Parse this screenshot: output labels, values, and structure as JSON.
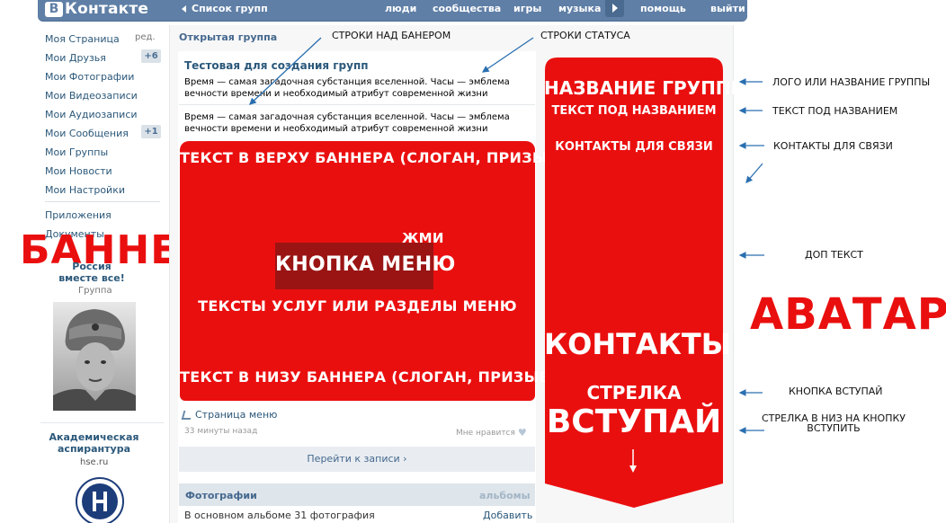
{
  "header": {
    "logo_text": "Контакте",
    "logo_letter": "В",
    "back_link": "Список групп",
    "nav": [
      "люди",
      "сообщества",
      "игры",
      "музыка",
      "помощь",
      "выйти"
    ]
  },
  "left_menu": {
    "edit_label": "ред.",
    "items": [
      {
        "label": "Моя Страница"
      },
      {
        "label": "Мои Друзья",
        "badge": "+6"
      },
      {
        "label": "Мои Фотографии"
      },
      {
        "label": "Мои Видеозаписи"
      },
      {
        "label": "Мои Аудиозаписи"
      },
      {
        "label": "Мои Сообщения",
        "badge": "+1"
      },
      {
        "label": "Мои Группы"
      },
      {
        "label": "Мои Новости"
      },
      {
        "label": "Мои Настройки"
      }
    ],
    "apps": "Приложения",
    "documents": "Документы"
  },
  "left_group": {
    "title": "Россия вместе все!",
    "type": "Группа"
  },
  "academy": {
    "title": "Академическая аспирантура",
    "url": "hse.ru"
  },
  "group_page": {
    "open_group_label": "Открытая группа",
    "title": "Тестовая для создания групп",
    "status_text_1": "Время — самая загадочная субстанция вселенной. Часы — эмблема вечности времени и необходимый атрибут современной жизни",
    "status_text_2": "Время — самая загадочная субстанция вселенной. Часы — эмблема вечности времени и необходимый атрибут современной жизни"
  },
  "banner": {
    "top_text": "ТЕКСТ В ВЕРХУ БАННЕРА (СЛОГАН, ПРИЗЫВ, ДЕВИЗ)",
    "press_text": "ЖМИ",
    "menu_button": "КНОПКА МЕНЮ",
    "services_text": "ТЕКСТЫ УСЛУГ ИЛИ РАЗДЕЛЫ МЕНЮ",
    "bottom_text": "ТЕКСТ В НИЗУ БАННЕРА (СЛОГАН, ПРИЗЫВ, ДЕВИЗ)",
    "color": "#ea0f0f",
    "button_color": "#9b1414"
  },
  "post": {
    "page_menu": "Страница меню",
    "time": "33 минуты назад",
    "likes": "Мне нравится",
    "to_post": "Перейти к записи"
  },
  "photos": {
    "title": "Фотографии",
    "albums": "альбомы",
    "info": "В основном альбоме 31 фотография",
    "add": "Добавить"
  },
  "avatar": {
    "name": "НАЗВАНИЕ ГРУППЫ",
    "sub": "ТЕКСТ ПОД НАЗВАНИЕМ",
    "contacts_small": "КОНТАКТЫ ДЛЯ СВЯЗИ",
    "contacts_big": "КОНТАКТЫ",
    "arrow_label": "СТРЕЛКА",
    "join": "ВСТУПАЙ"
  },
  "labels": {
    "banner": "БАННЕР",
    "avatar": "АВАТАР"
  },
  "annotations": {
    "rows_above_banner": "СТРОКИ НАД БАНЕРОМ",
    "status_rows": "СТРОКИ СТАТУСА",
    "logo_or_name": "ЛОГО ИЛИ НАЗВАНИЕ ГРУППЫ",
    "text_under_name": "ТЕКСТ ПОД НАЗВАНИЕМ",
    "contacts": "КОНТАКТЫ ДЛЯ СВЯЗИ",
    "extra_text": "ДОП ТЕКСТ",
    "join_button": "КНОПКА ВСТУПАЙ",
    "arrow_down_line1": "СТРЕЛКА В НИЗ НА КНОПКУ",
    "arrow_down_line2": "ВСТУПИТЬ"
  },
  "colors": {
    "accent_red": "#ea0f0f",
    "vk_blue": "#5f7fa6",
    "link_blue": "#2b587a",
    "annotation_arrow": "#2a6fb0"
  }
}
